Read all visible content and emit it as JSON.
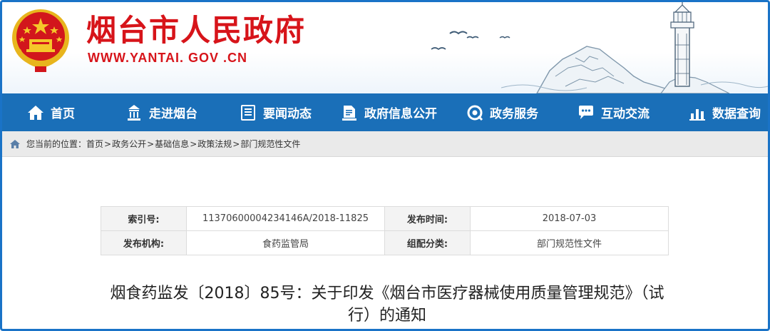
{
  "header": {
    "site_title": "烟台市人民政府",
    "site_url": "WWW.YANTAI. GOV .CN",
    "brand_color": "#d7141a"
  },
  "nav": {
    "background": "#1a6fb8",
    "items": [
      {
        "label": "首页",
        "icon": "home-icon"
      },
      {
        "label": "走进烟台",
        "icon": "building-icon"
      },
      {
        "label": "要闻动态",
        "icon": "news-icon"
      },
      {
        "label": "政府信息公开",
        "icon": "document-icon"
      },
      {
        "label": "政务服务",
        "icon": "service-icon"
      },
      {
        "label": "互动交流",
        "icon": "chat-icon"
      },
      {
        "label": "数据查询",
        "icon": "chart-icon"
      }
    ]
  },
  "breadcrumb": {
    "prefix": "您当前的位置：",
    "items": [
      "首页",
      "政务公开",
      "基础信息",
      "政策法规",
      "部门规范性文件"
    ],
    "separator": ">"
  },
  "info": {
    "rows": [
      {
        "k1": "索引号:",
        "v1": "11370600004234146A/2018-11825",
        "k2": "发布时间:",
        "v2": "2018-07-03"
      },
      {
        "k1": "发布机构:",
        "v1": "食药监管局",
        "k2": "组配分类:",
        "v2": "部门规范性文件"
      }
    ]
  },
  "document": {
    "title_line1": "烟食药监发〔2018〕85号：关于印发《烟台市医疗器械使用质量管理规范》（试",
    "title_line2": "行）的通知"
  }
}
